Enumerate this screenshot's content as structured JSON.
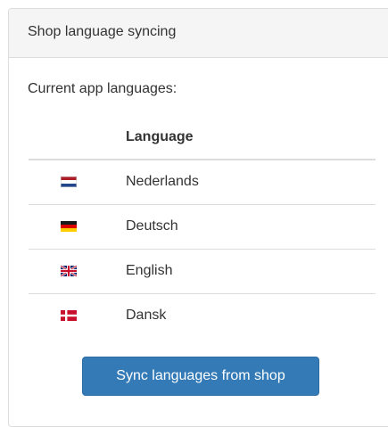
{
  "panel": {
    "title": "Shop language syncing"
  },
  "intro_text": "Current app languages:",
  "table": {
    "header_language": "Language",
    "rows": [
      {
        "flag_icon": "netherlands-flag-icon",
        "name": "Nederlands"
      },
      {
        "flag_icon": "germany-flag-icon",
        "name": "Deutsch"
      },
      {
        "flag_icon": "uk-flag-icon",
        "name": "English"
      },
      {
        "flag_icon": "denmark-flag-icon",
        "name": "Dansk"
      }
    ]
  },
  "sync_button": {
    "label": "Sync languages from shop"
  },
  "colors": {
    "button_primary": "#337ab7",
    "panel_heading_bg": "#f5f5f5",
    "border": "#dddddd"
  }
}
